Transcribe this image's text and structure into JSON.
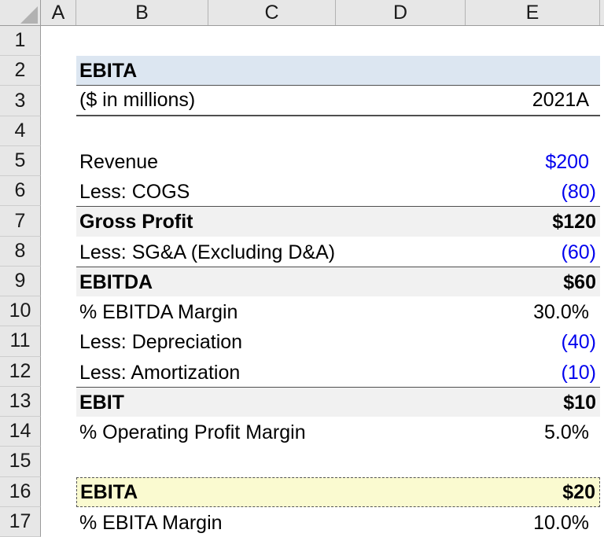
{
  "spreadsheet": {
    "column_headers": {
      "a": "A",
      "b": "B",
      "c": "C",
      "d": "D",
      "e": "E"
    },
    "rows": [
      {
        "num": "1",
        "label": "",
        "value": ""
      },
      {
        "num": "2",
        "label": "EBITA",
        "value": ""
      },
      {
        "num": "3",
        "label": "($ in millions)",
        "value": "2021A"
      },
      {
        "num": "4",
        "label": "",
        "value": ""
      },
      {
        "num": "5",
        "label": "Revenue",
        "value": "$200"
      },
      {
        "num": "6",
        "label": "Less: COGS",
        "value": "(80)"
      },
      {
        "num": "7",
        "label": "Gross Profit",
        "value": "$120"
      },
      {
        "num": "8",
        "label": "Less: SG&A (Excluding D&A)",
        "value": "(60)"
      },
      {
        "num": "9",
        "label": "EBITDA",
        "value": "$60"
      },
      {
        "num": "10",
        "label": "% EBITDA Margin",
        "value": "30.0%"
      },
      {
        "num": "11",
        "label": "Less: Depreciation",
        "value": "(40)"
      },
      {
        "num": "12",
        "label": "Less: Amortization",
        "value": "(10)"
      },
      {
        "num": "13",
        "label": "EBIT",
        "value": "$10"
      },
      {
        "num": "14",
        "label": "% Operating Profit Margin",
        "value": "5.0%"
      },
      {
        "num": "15",
        "label": "",
        "value": ""
      },
      {
        "num": "16",
        "label": "EBITA",
        "value": "$20"
      },
      {
        "num": "17",
        "label": "% EBITA Margin",
        "value": "10.0%"
      }
    ],
    "colors": {
      "title_fill": "#dce6f1",
      "subtotal_fill": "#f1f1f1",
      "highlight_fill": "#fafad0",
      "input_text": "#0000ee",
      "border_dark": "#4f4f4f"
    }
  }
}
